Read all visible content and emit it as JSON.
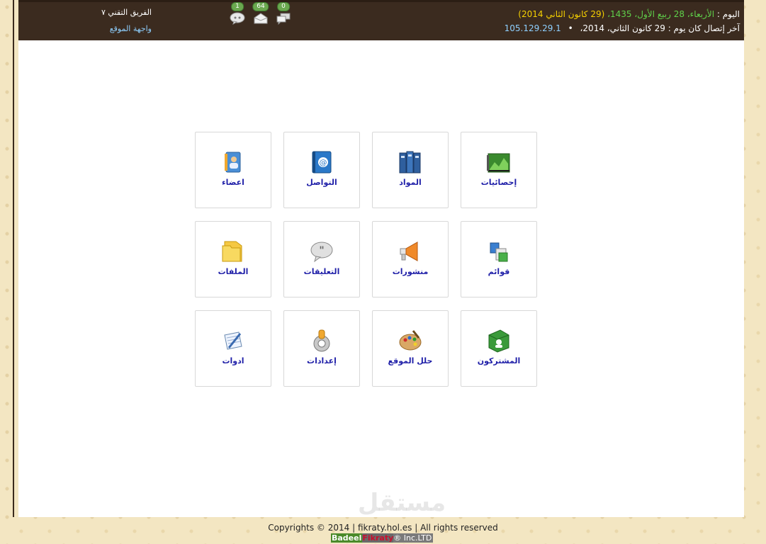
{
  "topbar": {
    "today_label": "اليوم :",
    "today_hijri": "الأربعاء، 28 ربيع الأول، 1435،",
    "today_gregorian": "(29 كانون الثاني 2014)",
    "last_visit": "آخر إتصال كان يوم : 29 كانون الثاني، 2014،",
    "bullet": "•",
    "ip": "105.129.29.1"
  },
  "user": {
    "name": "الفريق التقني ٧",
    "site_link": "واجهة الموقع"
  },
  "notifications": [
    {
      "count": "1",
      "icon": "comment-icon"
    },
    {
      "count": "64",
      "icon": "mail-icon"
    },
    {
      "count": "0",
      "icon": "chat-icon"
    }
  ],
  "tiles": [
    {
      "label": "إحصائيات",
      "icon": "statistics-icon"
    },
    {
      "label": "المواد",
      "icon": "books-icon"
    },
    {
      "label": "التواصل",
      "icon": "address-book-icon"
    },
    {
      "label": "اعضاء",
      "icon": "members-icon"
    },
    {
      "label": "قوائم",
      "icon": "menus-icon"
    },
    {
      "label": "منشورات",
      "icon": "megaphone-icon"
    },
    {
      "label": "التعليقات",
      "icon": "comments-icon"
    },
    {
      "label": "الملفات",
      "icon": "folder-icon"
    },
    {
      "label": "المشتركون",
      "icon": "subscribers-icon"
    },
    {
      "label": "حلل الموقع",
      "icon": "palette-icon"
    },
    {
      "label": "إعدادات",
      "icon": "settings-gear-icon"
    },
    {
      "label": "ادوات",
      "icon": "tools-notepad-icon"
    }
  ],
  "watermark": "مستقل",
  "footer": {
    "copyright": "Copyrights © 2014 | fikraty.hol.es |   All rights reserved",
    "credit_badeel": "Badeel",
    "credit_fikraty": "Fikraty",
    "credit_suffix": "® Inc.LTD"
  },
  "colors": {
    "topbar": "#3b2b1f",
    "tile_label": "#1f1fa8",
    "green_text": "#5fd04a",
    "yellow_text": "#f5d000",
    "link_blue": "#8fd0ff"
  }
}
